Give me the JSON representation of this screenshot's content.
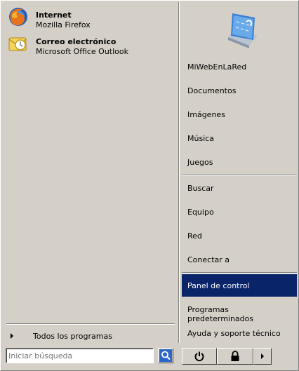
{
  "pinned": [
    {
      "title": "Internet",
      "subtitle": "Mozilla Firefox",
      "icon": "firefox-icon"
    },
    {
      "title": "Correo electrónico",
      "subtitle": "Microsoft Office Outlook",
      "icon": "outlook-icon"
    }
  ],
  "all_programs": "Todos los programas",
  "user_picture": "user-picture-icon",
  "right_items": [
    "MiWebEnLaRed",
    "Documentos",
    "Imágenes",
    "Música",
    "Juegos",
    "Buscar",
    "Equipo",
    "Red",
    "Conectar a",
    "Panel de control",
    "Programas predeterminados",
    "Ayuda y soporte técnico"
  ],
  "selected_item": "Panel de control",
  "search": {
    "placeholder": "Iniciar búsqueda"
  },
  "colors": {
    "background": "#d4d0c8",
    "selection": "#0a246a",
    "selection_text": "#ffffff"
  }
}
